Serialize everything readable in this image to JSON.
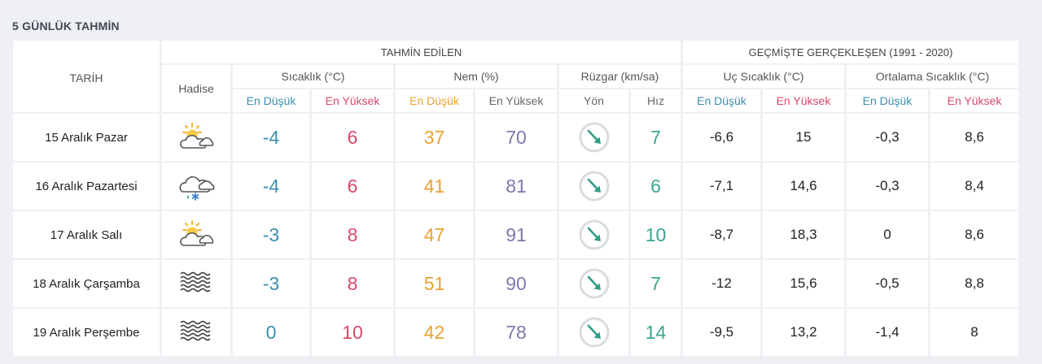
{
  "title": "5 GÜNLÜK TAHMİN",
  "headers": {
    "tarih": "TARİH",
    "hadise": "Hadise",
    "tahmin_edilen": "TAHMİN EDİLEN",
    "gecmiste": "GEÇMİŞTE GERÇEKLEŞEN (1991 - 2020)",
    "sicaklik": "Sıcaklık (°C)",
    "nem": "Nem (%)",
    "ruzgar": "Rüzgar (km/sa)",
    "uc_sicaklik": "Uç Sıcaklık (°C)",
    "ortalama_sicaklik": "Ortalama Sıcaklık (°C)",
    "en_dusuk": "En Düşük",
    "en_yuksek": "En Yüksek",
    "yon": "Yön",
    "hiz": "Hız"
  },
  "rows": [
    {
      "date": "15 Aralık Pazar",
      "icon": "partly-cloudy-sun-icon",
      "temp_low": "-4",
      "temp_high": "6",
      "hum_low": "37",
      "hum_high": "70",
      "wind_dir": "wind-southeast-arrow-icon",
      "wind_speed": "7",
      "ext_low": "-6,6",
      "ext_high": "15",
      "avg_low": "-0,3",
      "avg_high": "8,6"
    },
    {
      "date": "16 Aralık Pazartesi",
      "icon": "sleet-cloud-icon",
      "temp_low": "-4",
      "temp_high": "6",
      "hum_low": "41",
      "hum_high": "81",
      "wind_dir": "wind-southeast-arrow-icon",
      "wind_speed": "6",
      "ext_low": "-7,1",
      "ext_high": "14,6",
      "avg_low": "-0,3",
      "avg_high": "8,4"
    },
    {
      "date": "17 Aralık Salı",
      "icon": "partly-cloudy-sun-icon",
      "temp_low": "-3",
      "temp_high": "8",
      "hum_low": "47",
      "hum_high": "91",
      "wind_dir": "wind-southeast-arrow-icon",
      "wind_speed": "10",
      "ext_low": "-8,7",
      "ext_high": "18,3",
      "avg_low": "0",
      "avg_high": "8,6"
    },
    {
      "date": "18 Aralık Çarşamba",
      "icon": "fog-haze-icon",
      "temp_low": "-3",
      "temp_high": "8",
      "hum_low": "51",
      "hum_high": "90",
      "wind_dir": "wind-southeast-arrow-icon",
      "wind_speed": "7",
      "ext_low": "-12",
      "ext_high": "15,6",
      "avg_low": "-0,5",
      "avg_high": "8,8"
    },
    {
      "date": "19 Aralık Perşembe",
      "icon": "fog-haze-icon",
      "temp_low": "0",
      "temp_high": "10",
      "hum_low": "42",
      "hum_high": "78",
      "wind_dir": "wind-southeast-arrow-icon",
      "wind_speed": "14",
      "ext_low": "-9,5",
      "ext_high": "13,2",
      "avg_low": "-1,4",
      "avg_high": "8"
    }
  ],
  "colors": {
    "low_temp": "#3c8fb0",
    "high_temp": "#d9496a",
    "humidity_low": "#e8a22d",
    "humidity_high": "#7f78ad",
    "wind": "#38a68f",
    "background": "#eef0f3"
  }
}
